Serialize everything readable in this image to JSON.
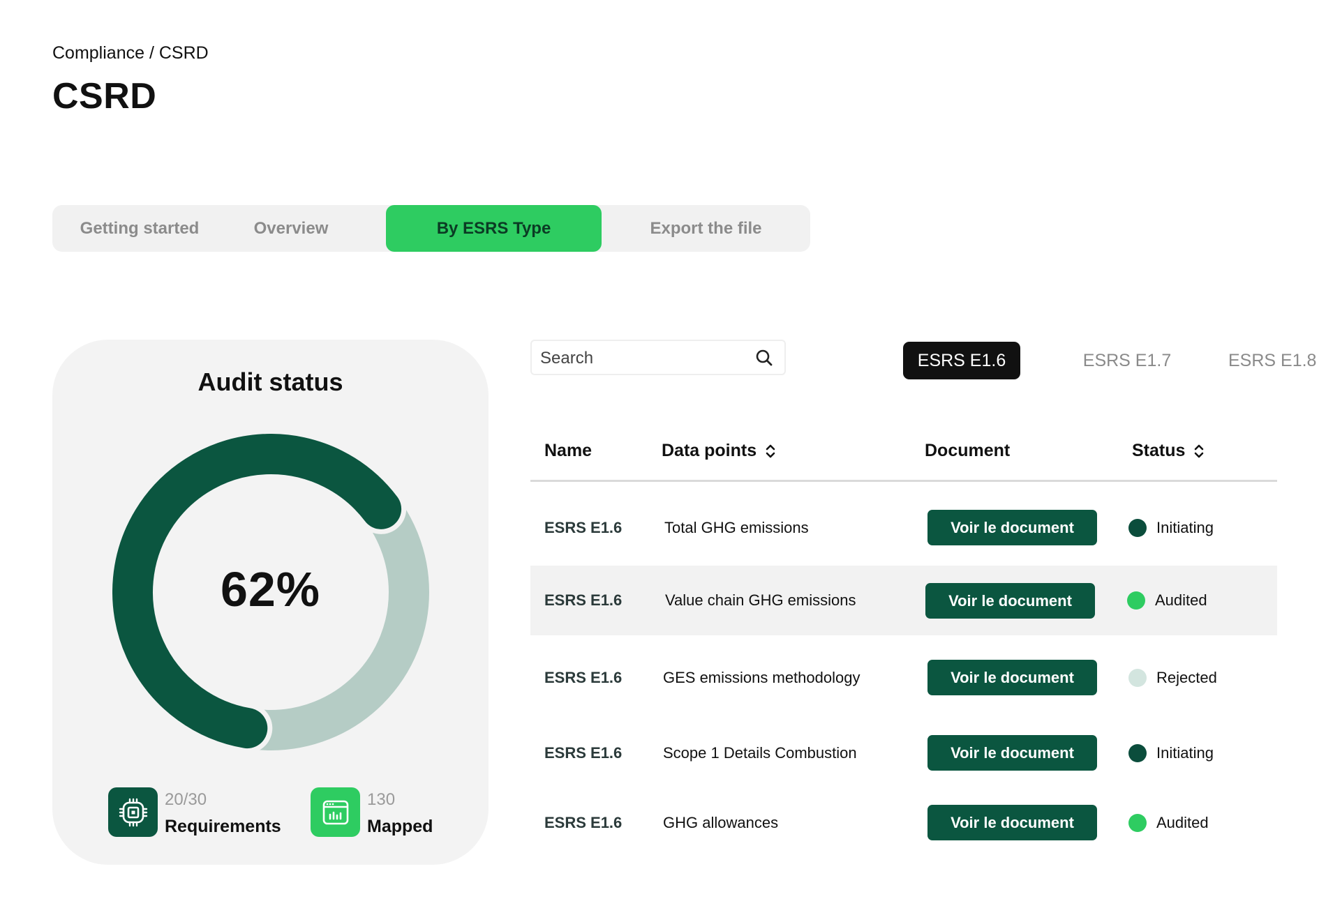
{
  "breadcrumb": "Compliance / CSRD",
  "page_title": "CSRD",
  "tabs": [
    {
      "label": "Getting started",
      "active": false
    },
    {
      "label": "Overview",
      "active": false
    },
    {
      "label": "By ESRS Type",
      "active": true
    },
    {
      "label": "Export the file",
      "active": false
    }
  ],
  "audit": {
    "title": "Audit status",
    "percent_label": "62%",
    "percent_value": 62,
    "requirements": {
      "count": "20/30",
      "label": "Requirements",
      "icon": "chip-icon"
    },
    "mapped": {
      "count": "130",
      "label": "Mapped",
      "icon": "chart-window-icon"
    }
  },
  "search": {
    "placeholder": "Search",
    "value": ""
  },
  "filters": [
    {
      "label": "ESRS E1.6",
      "active": true
    },
    {
      "label": "ESRS E1.7",
      "active": false
    },
    {
      "label": "ESRS E1.8",
      "active": false
    }
  ],
  "table": {
    "columns": [
      "Name",
      "Data points",
      "Document",
      "Status"
    ],
    "rows": [
      {
        "name": "ESRS E1.6",
        "data_point": "Total GHG emissions",
        "document": "Voir le document",
        "status": "Initiating"
      },
      {
        "name": "ESRS E1.6",
        "data_point": "Value chain GHG emissions",
        "document": "Voir le document",
        "status": "Audited"
      },
      {
        "name": "ESRS E1.6",
        "data_point": "GES emissions methodology",
        "document": "Voir le document",
        "status": "Rejected"
      },
      {
        "name": "ESRS E1.6",
        "data_point": "Scope 1 Details Combustion",
        "document": "Voir le document",
        "status": "Initiating"
      },
      {
        "name": "ESRS E1.6",
        "data_point": "GHG allowances",
        "document": "Voir le document",
        "status": "Audited"
      }
    ]
  },
  "colors": {
    "accent_green": "#2ecc61",
    "dark_green": "#0b5640",
    "light_green": "#b5ccc5",
    "status_initiating": "#0b4d3c",
    "status_audited": "#2ecc61",
    "status_rejected": "#d3e5df"
  }
}
